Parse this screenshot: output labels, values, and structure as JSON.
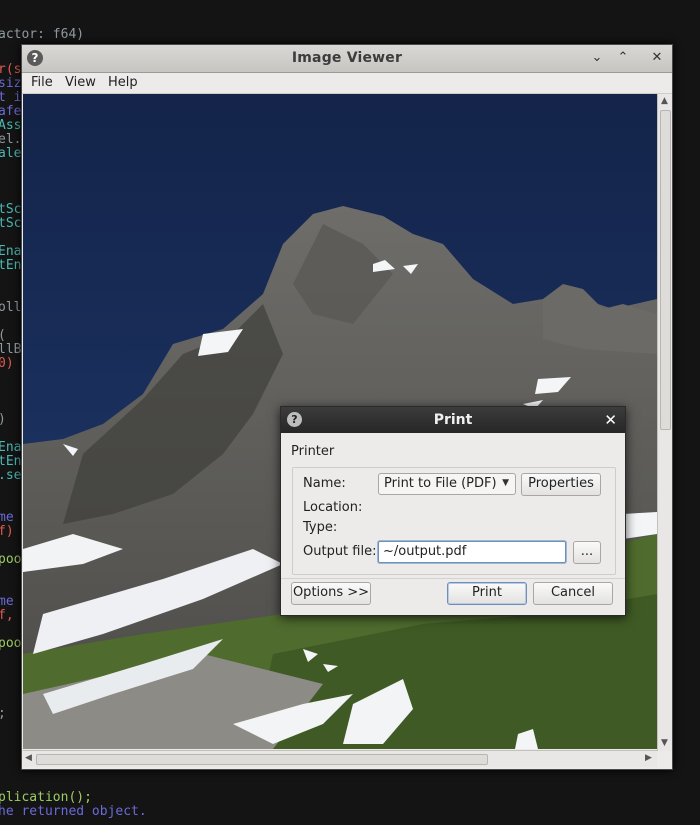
{
  "background_code": {
    "lines": [
      "actor: f64)",
      "r(s",
      "siz",
      "t i",
      "afe",
      "Ass",
      "el.",
      "ale",
      "tSc",
      "tSc",
      "Ena",
      "tEn",
      "oll",
      "(",
      "llB",
      "0)",
      ")",
      "Ena",
      "tEn",
      ".se",
      "me",
      "f)",
      "poo",
      "me",
      "f,",
      "poo",
      ";",
      "plication();",
      "he returned object."
    ]
  },
  "window": {
    "title": "Image Viewer",
    "menu": [
      "File",
      "View",
      "Help"
    ],
    "controls": {
      "minimize": "⌄",
      "maximize": "⌃",
      "close": "✕"
    }
  },
  "print_dialog": {
    "title": "Print",
    "section_label": "Printer",
    "name_label": "Name:",
    "printer_selected": "Print to File (PDF)",
    "properties_button": "Properties",
    "location_label": "Location:",
    "type_label": "Type:",
    "output_file_label": "Output file:",
    "output_file_value": "~/output.pdf",
    "browse_button": "...",
    "options_button": "Options >>",
    "print_button": "Print",
    "cancel_button": "Cancel"
  }
}
